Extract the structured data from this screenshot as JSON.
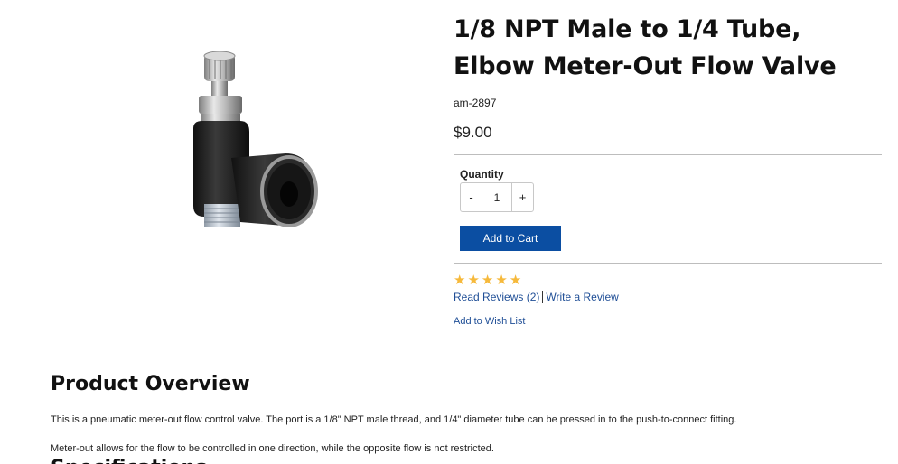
{
  "product": {
    "title": "1/8 NPT Male to 1/4 Tube, Elbow Meter-Out Flow Valve",
    "sku": "am-2897",
    "price": "$9.00",
    "image_alt": "Elbow meter-out flow valve"
  },
  "purchase": {
    "quantity_label": "Quantity",
    "decrement_label": "-",
    "quantity_value": "1",
    "increment_label": "+",
    "add_to_cart_label": "Add to Cart"
  },
  "reviews": {
    "rating": 5,
    "max_rating": 5,
    "star_glyph": "★",
    "read_reviews_label": "Read Reviews (2)",
    "write_review_label": "Write a Review",
    "star_color": "#f6b93b"
  },
  "wishlist": {
    "label": "Add to Wish List"
  },
  "overview": {
    "heading": "Product Overview",
    "paragraphs": [
      "This is a pneumatic meter-out flow control valve. The port is a 1/8\" NPT male thread, and 1/4\" diameter tube can be pressed in to the push-to-connect fitting.",
      "Meter-out allows for the flow to be controlled in one direction, while the opposite flow is not restricted."
    ],
    "next_heading": "Specifications"
  },
  "colors": {
    "accent": "#0b4ea2",
    "link": "#1f4e96"
  }
}
